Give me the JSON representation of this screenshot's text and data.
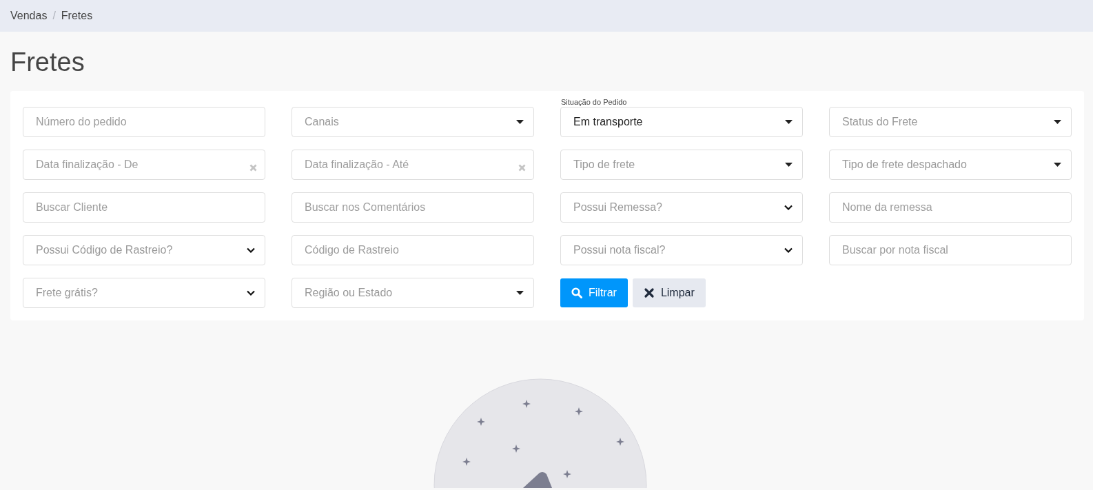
{
  "breadcrumb": {
    "separator": "/",
    "items": [
      {
        "label": "Vendas"
      },
      {
        "label": "Fretes"
      }
    ]
  },
  "page_title": "Fretes",
  "filters": [
    {
      "kind": "text",
      "placeholder": "Número do pedido"
    },
    {
      "kind": "select",
      "placeholder": "Canais"
    },
    {
      "kind": "select",
      "label": "Situação do Pedido",
      "value": "Em transporte"
    },
    {
      "kind": "select",
      "placeholder": "Status do Frete"
    },
    {
      "kind": "date",
      "placeholder": "Data finalização - De"
    },
    {
      "kind": "date",
      "placeholder": "Data finalização - Até"
    },
    {
      "kind": "select",
      "placeholder": "Tipo de frete"
    },
    {
      "kind": "select",
      "placeholder": "Tipo de frete despachado"
    },
    {
      "kind": "text",
      "placeholder": "Buscar Cliente"
    },
    {
      "kind": "text",
      "placeholder": "Buscar nos Comentários"
    },
    {
      "kind": "native",
      "placeholder": "Possui Remessa?"
    },
    {
      "kind": "text",
      "placeholder": "Nome da remessa"
    },
    {
      "kind": "native",
      "placeholder": "Possui Código de Rastreio?"
    },
    {
      "kind": "text",
      "placeholder": "Código de Rastreio"
    },
    {
      "kind": "native",
      "placeholder": "Possui nota fiscal?"
    },
    {
      "kind": "text",
      "placeholder": "Buscar por nota fiscal"
    },
    {
      "kind": "native",
      "placeholder": "Frete grátis?"
    },
    {
      "kind": "select",
      "placeholder": "Região ou Estado"
    }
  ],
  "buttons": [
    {
      "kind": "primary",
      "label": "Filtrar"
    },
    {
      "kind": "secondary",
      "label": "Limpar"
    }
  ]
}
